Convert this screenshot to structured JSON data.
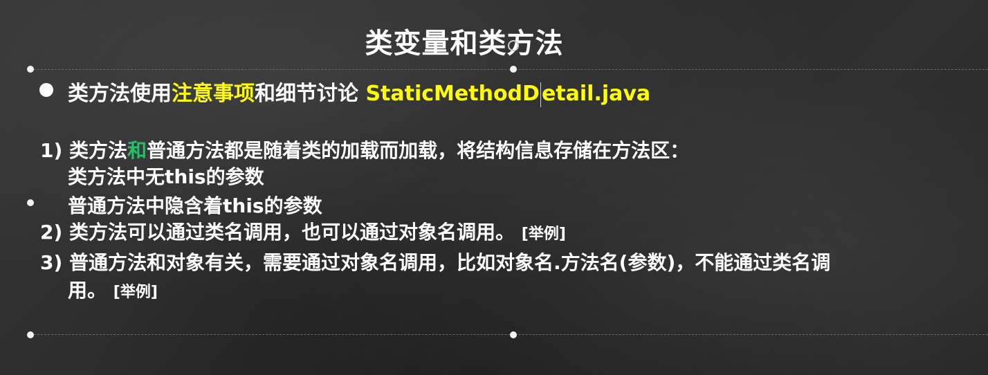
{
  "slide": {
    "title": "类变量和类方法",
    "heading": {
      "part1": "类方法使用",
      "part2_highlight": "注意事项",
      "part3": "和细节讨论",
      "file_a": "StaticMethodD",
      "file_b": "etail.java"
    },
    "items": {
      "i1_num": "1)",
      "i1_a": "类方法",
      "i1_hl": "和",
      "i1_b": "普通方法都是随着类的加载而加载，将结构信息存储在方法区：",
      "i1_sub1": "类方法中无this的参数",
      "i1_sub2": "普通方法中隐含着this的参数",
      "i2_num": "2)",
      "i2_text": "类方法可以通过类名调用，也可以通过对象名调用。",
      "i2_example": "[举例]",
      "i3_num": "3)",
      "i3_line1": "普通方法和对象有关，需要通过对象名调用，比如对象名.方法名(参数)，不能通过类名调",
      "i3_line2": "用。",
      "i3_example": "[举例]"
    }
  },
  "colors": {
    "background": "#2d2d2d",
    "text": "#ffffff",
    "highlight": "#ffff00",
    "cursor_highlight": "#23c26a"
  }
}
